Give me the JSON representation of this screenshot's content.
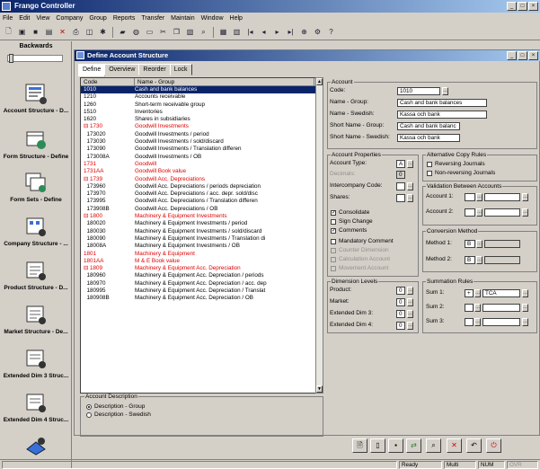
{
  "app": {
    "title": "Frango Controller"
  },
  "menu": [
    "File",
    "Edit",
    "View",
    "Company",
    "Group",
    "Reports",
    "Transfer",
    "Maintain",
    "Window",
    "Help"
  ],
  "toolbar_icons": [
    "new-icon",
    "open-icon",
    "save-icon",
    "save-all-icon",
    "delete-icon",
    "print-icon",
    "print-preview-icon",
    "properties-icon",
    "open-folder-icon",
    "refresh-icon",
    "cut-icon",
    "copy-icon",
    "paste-icon",
    "find-icon",
    "calendar-icon",
    "lock-icon",
    "first-icon",
    "previous-icon",
    "next-icon",
    "last-icon",
    "zoom-icon",
    "tools-icon",
    "help-icon"
  ],
  "sidebar": {
    "header": "Backwards",
    "items": [
      {
        "label": "Account Structure - D...",
        "icon": "account-structure-icon"
      },
      {
        "label": "Form Structure - Define",
        "icon": "form-structure-icon"
      },
      {
        "label": "Form Sets - Define",
        "icon": "form-sets-icon"
      },
      {
        "label": "Company Structure - ...",
        "icon": "company-structure-icon"
      },
      {
        "label": "Product Structure - D...",
        "icon": "product-structure-icon"
      },
      {
        "label": "Market Structure - De...",
        "icon": "market-structure-icon"
      },
      {
        "label": "Extended Dim 3 Struc...",
        "icon": "extended-dim-3-icon"
      },
      {
        "label": "Extended Dim 4 Struc...",
        "icon": "extended-dim-4-icon"
      },
      {
        "label": "",
        "icon": "extended-dim-next-icon"
      }
    ]
  },
  "window": {
    "title": "Define Account Structure",
    "tabs": [
      "Define",
      "Overview",
      "Reorder",
      "Lock"
    ]
  },
  "grid": {
    "headers": [
      "Code",
      "Name - Group"
    ],
    "rows": [
      {
        "code": "1010",
        "name": "Cash and bank balances",
        "style": "sel"
      },
      {
        "code": "1210",
        "name": "Accounts receivable",
        "style": ""
      },
      {
        "code": "1260",
        "name": "Short-term receivable group",
        "style": ""
      },
      {
        "code": "1510",
        "name": "Inventories",
        "style": ""
      },
      {
        "code": "1620",
        "name": "Shares in subsidiaries",
        "style": ""
      },
      {
        "code": "⊟ 1730",
        "name": "Goodwill Investments",
        "style": "red"
      },
      {
        "code": "  173020",
        "name": "Goodwill Investments / period",
        "style": ""
      },
      {
        "code": "  173030",
        "name": "Goodwill Investments / sold/discard",
        "style": ""
      },
      {
        "code": "  173090",
        "name": "Goodwill Investments / Translation differen",
        "style": ""
      },
      {
        "code": "  173008A",
        "name": "Goodwill Investments / OB",
        "style": ""
      },
      {
        "code": "1731",
        "name": "Goodwill",
        "style": "red"
      },
      {
        "code": "1731AA",
        "name": "Goodwill Book value",
        "style": "red"
      },
      {
        "code": "⊟ 1739",
        "name": "Goodwill Acc. Depreciations",
        "style": "red"
      },
      {
        "code": "  173960",
        "name": "Goodwill Acc. Depreciations / periods depreciation",
        "style": ""
      },
      {
        "code": "  173970",
        "name": "Goodwill Acc. Depreciations / acc. depr. sold/disc",
        "style": ""
      },
      {
        "code": "  173995",
        "name": "Goodwill Acc. Depreciations / Translation differen",
        "style": ""
      },
      {
        "code": "  173908B",
        "name": "Goodwill Acc. Depreciations / OB",
        "style": ""
      },
      {
        "code": "⊟ 1800",
        "name": "Machinery & Equipment Investments",
        "style": "red"
      },
      {
        "code": "  180020",
        "name": "Machinery & Equipment Investments / period",
        "style": ""
      },
      {
        "code": "  180030",
        "name": "Machinery & Equipment Investments / sold/discard",
        "style": ""
      },
      {
        "code": "  180090",
        "name": "Machinery & Equipment Investments / Translation di",
        "style": ""
      },
      {
        "code": "  18008A",
        "name": "Machinery & Equipment Investments / OB",
        "style": ""
      },
      {
        "code": "1801",
        "name": "Machinery & Equipment",
        "style": "red"
      },
      {
        "code": "1801AA",
        "name": "M & E Book value",
        "style": "red"
      },
      {
        "code": "⊟ 1809",
        "name": "Machinery & Equipment Acc. Depreciation",
        "style": "red"
      },
      {
        "code": "  180960",
        "name": "Machinery & Equipment Acc. Depreciation / periods",
        "style": ""
      },
      {
        "code": "  180970",
        "name": "Machinery & Equipment Acc. Depreciation / acc. dep",
        "style": ""
      },
      {
        "code": "  180995",
        "name": "Machinery & Equipment Acc. Depreciation / Translat",
        "style": ""
      },
      {
        "code": "  180908B",
        "name": "Machinery & Equipment Acc. Depreciation / OB",
        "style": ""
      }
    ]
  },
  "account_description": {
    "label": "Account Description",
    "options": [
      "Description - Group",
      "Description - Swedish"
    ],
    "selected": 0
  },
  "account": {
    "group_label": "Account",
    "code_label": "Code:",
    "code_value": "1010",
    "name_group_label": "Name - Group:",
    "name_group_value": "Cash and bank balances",
    "name_swedish_label": "Name - Swedish:",
    "name_swedish_value": "Kassa och bank",
    "short_group_label": "Short Name - Group:",
    "short_group_value": "Cash and bank balanc",
    "short_swedish_label": "Short Name - Swedish:",
    "short_swedish_value": "Kassa och bank"
  },
  "properties": {
    "group_label": "Account Properties",
    "type_label": "Account Type:",
    "type_value": "A",
    "decimals_label": "Decimals:",
    "decimals_value": "0",
    "interco_label": "Intercompany Code:",
    "shares_label": "Shares:",
    "checks": [
      {
        "label": "Consolidate",
        "checked": true,
        "disabled": false
      },
      {
        "label": "Sign Change",
        "checked": false,
        "disabled": false
      },
      {
        "label": "Comments",
        "checked": true,
        "disabled": false
      },
      {
        "label": "Mandatory Comment",
        "checked": false,
        "disabled": false
      },
      {
        "label": "Counter Dimension",
        "checked": false,
        "disabled": true
      },
      {
        "label": "Calculation Account",
        "checked": false,
        "disabled": true
      },
      {
        "label": "Movement Account",
        "checked": false,
        "disabled": true
      }
    ]
  },
  "copy_rules": {
    "group_label": "Alternative Copy Rules",
    "checks": [
      "Reversing Journals",
      "Non-reversing Journals"
    ]
  },
  "validation": {
    "group_label": "Validation Between Accounts",
    "account1_label": "Account 1:",
    "account2_label": "Account 2:"
  },
  "conversion": {
    "group_label": "Conversion Method",
    "method1_label": "Method 1:",
    "method1_value": "B",
    "method2_label": "Method 2:",
    "method2_value": "B"
  },
  "dimension": {
    "group_label": "Dimension Levels",
    "product_label": "Product:",
    "product_value": "0",
    "market_label": "Market:",
    "market_value": "0",
    "ext3_label": "Extended Dim 3:",
    "ext3_value": "0",
    "ext4_label": "Extended Dim 4:",
    "ext4_value": "0"
  },
  "summation": {
    "group_label": "Summation Rules",
    "sum1_label": "Sum 1:",
    "sum1_sign": "+",
    "sum1_value": "TCA",
    "sum2_label": "Sum 2:",
    "sum3_label": "Sum 3:"
  },
  "bottom_buttons": [
    "new-record-icon",
    "blank-page-icon",
    "save-disk-icon",
    "copy-records-icon",
    "find-binoculars-icon",
    "delete-x-icon",
    "undo-icon",
    "exit-icon"
  ],
  "status": {
    "ready": "Ready",
    "mult": "Multi",
    "num": "NUM",
    "ovr": "OVR"
  }
}
